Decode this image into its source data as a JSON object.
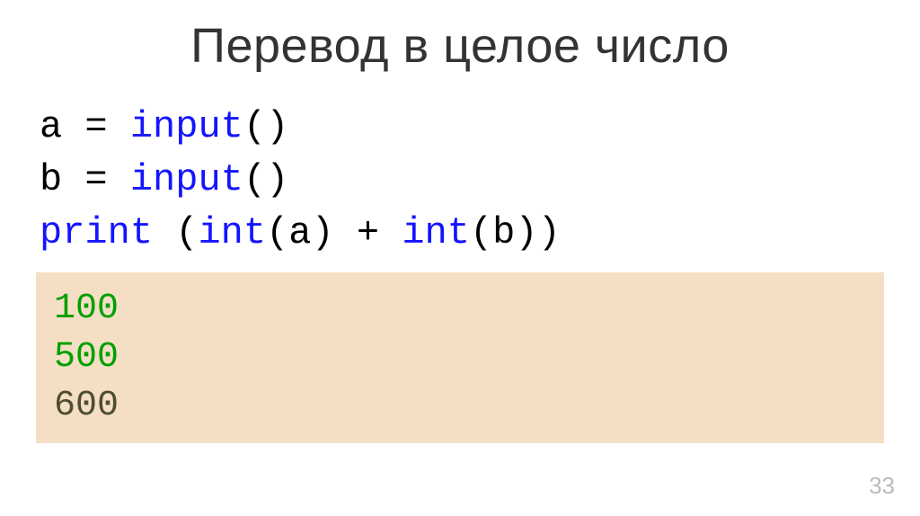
{
  "title": "Перевод в целое число",
  "code": {
    "line1": {
      "var": "a",
      "assign": " = ",
      "fn": "input",
      "paren": "()"
    },
    "line2": {
      "var": "b",
      "assign": " = ",
      "fn": "input",
      "paren": "()"
    },
    "line3": {
      "fn1": "print",
      "space1": " ",
      "paren_open": "(",
      "int1": "int",
      "arg1": "(a)",
      "plus": " + ",
      "int2": "int",
      "arg2": "(b)",
      "paren_close": ")"
    }
  },
  "output": {
    "line1": "100",
    "line2": "500",
    "line3": "600"
  },
  "page_number": "33"
}
